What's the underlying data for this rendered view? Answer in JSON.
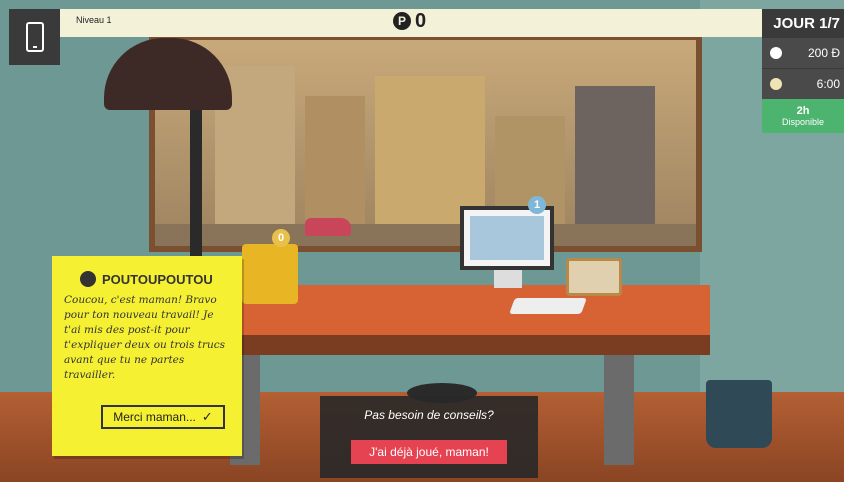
{
  "hud": {
    "level": "Niveau 1",
    "coin_symbol": "P",
    "coins": "0",
    "day": "JOUR 1/7",
    "money": "200 Ð",
    "time": "6:00",
    "available_hours": "2h",
    "available_label": "Disponible"
  },
  "scene": {
    "monitor_badge": "1",
    "tray_badge": "0"
  },
  "note": {
    "sender": "POUTOUPOUTOU",
    "message": "Coucou, c'est maman! Bravo pour ton nouveau travail! Je t'ai mis des post-it pour t'expliquer deux ou trois trucs avant que tu ne partes travailler.",
    "button_label": "Merci maman...",
    "button_check": "✓"
  },
  "overlay": {
    "question": "Pas besoin de conseils?",
    "button_label": "J'ai déjà joué, maman!"
  },
  "colors": {
    "note": "#f6f033",
    "skip_button": "#e64352",
    "available": "#4cb46e",
    "desk": "#d76233"
  }
}
